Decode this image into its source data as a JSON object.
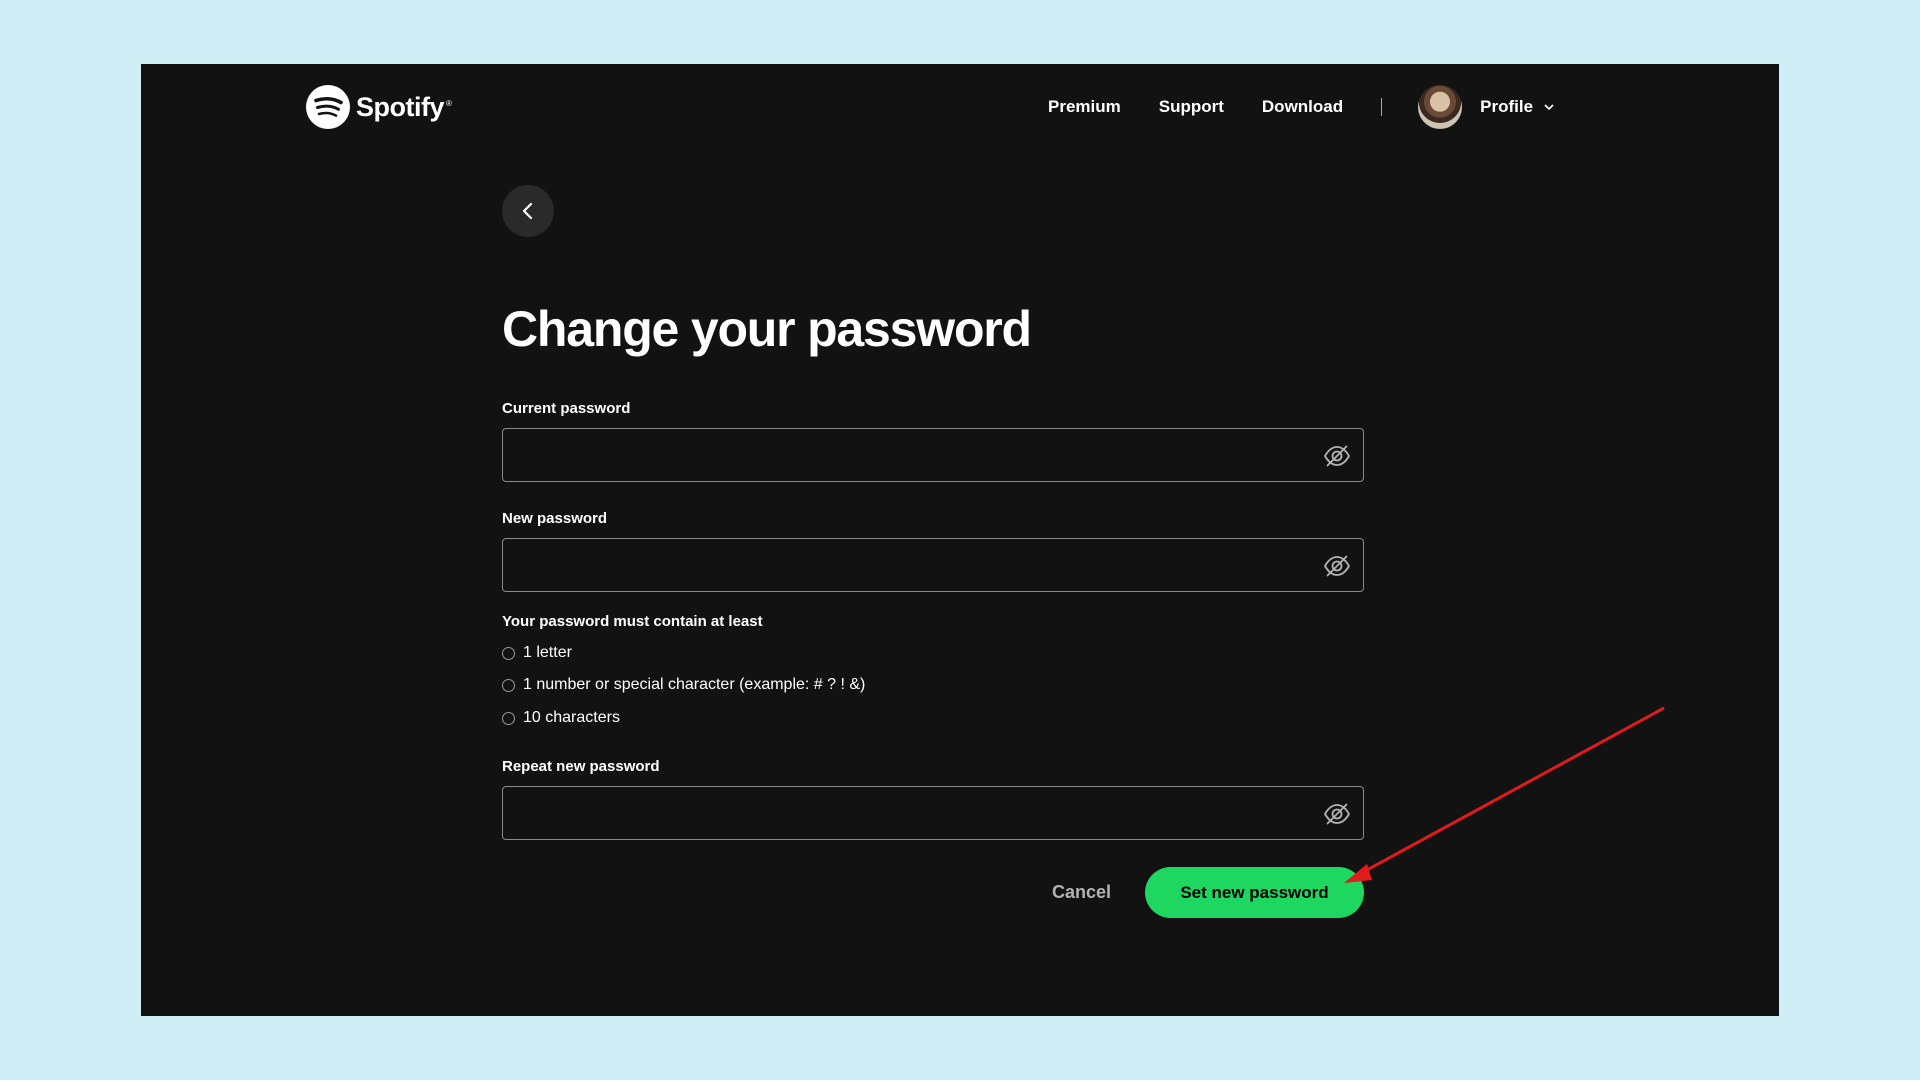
{
  "header": {
    "brand": "Spotify",
    "nav": {
      "premium": "Premium",
      "support": "Support",
      "download": "Download"
    },
    "profile_label": "Profile"
  },
  "page": {
    "title": "Change your password"
  },
  "form": {
    "current_password_label": "Current password",
    "current_password_value": "",
    "new_password_label": "New password",
    "new_password_value": "",
    "requirements_title": "Your password must contain at least",
    "requirements": [
      "1 letter",
      "1 number or special character (example: # ? ! &)",
      "10 characters"
    ],
    "repeat_password_label": "Repeat new password",
    "repeat_password_value": "",
    "cancel_label": "Cancel",
    "submit_label": "Set new password"
  },
  "colors": {
    "background": "#121212",
    "accent": "#1ed760",
    "outer": "#d0eef5",
    "annotation_arrow": "#e01b1b"
  },
  "icons": [
    "spotify-logo-icon",
    "chevron-down-icon",
    "back-arrow-icon",
    "eye-off-icon"
  ]
}
